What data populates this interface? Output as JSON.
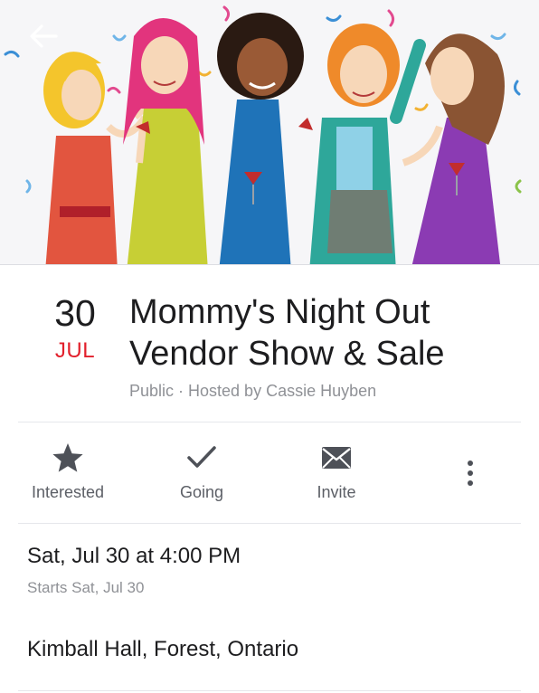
{
  "cover": {
    "image_icon": "party-women-illustration"
  },
  "nav": {
    "back_icon": "back-arrow-icon"
  },
  "event": {
    "day": "30",
    "month": "JUL",
    "title_line1": "Mommy's Night Out",
    "title_line2": "Vendor Show & Sale",
    "subtitle": "Public · Hosted by Cassie Huyben"
  },
  "actions": [
    {
      "label": "Interested",
      "icon": "star-icon"
    },
    {
      "label": "Going",
      "icon": "checkmark-icon"
    },
    {
      "label": "Invite",
      "icon": "envelope-icon"
    }
  ],
  "more_icon": "more-vertical-icon",
  "details": {
    "when": "Sat, Jul 30 at 4:00 PM",
    "starts": "Starts Sat, Jul 30",
    "where": "Kimball Hall, Forest, Ontario"
  },
  "colors": {
    "accent_red": "#e2202c",
    "icon_gray": "#5c5f66",
    "muted_text": "#8f9196"
  }
}
